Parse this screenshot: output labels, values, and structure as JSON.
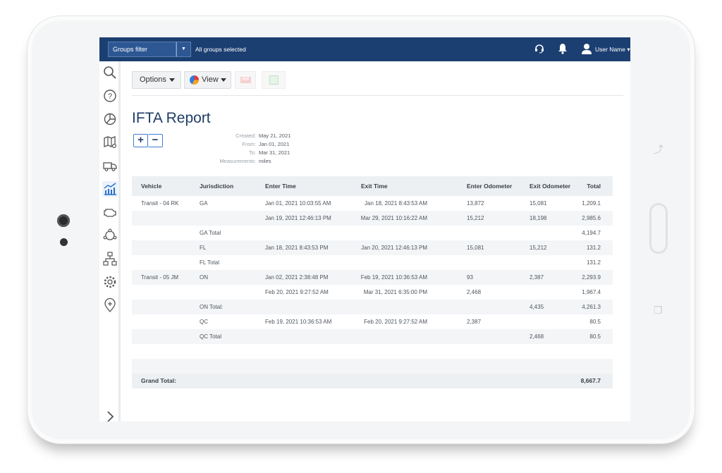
{
  "topbar": {
    "groups_filter_label": "Groups filter",
    "groups_selected": "All groups selected",
    "user_name": "User Name ▾"
  },
  "toolbar": {
    "options_label": "Options",
    "view_label": "View",
    "pdf_label": "PDF"
  },
  "report": {
    "title": "IFTA Report",
    "zoom_in": "+",
    "zoom_out": "−",
    "meta": [
      {
        "label": "Created:",
        "value": "May 21, 2021"
      },
      {
        "label": "From:",
        "value": "Jan 01, 2021"
      },
      {
        "label": "To:",
        "value": "Mar 31, 2021"
      },
      {
        "label": "Measurements:",
        "value": "miles"
      }
    ]
  },
  "table": {
    "headers": [
      "Vehicle",
      "Jurisdiction",
      "Enter Time",
      "Exit Time",
      "Enter Odometer",
      "Exit Odometer",
      "Total"
    ],
    "rows": [
      [
        "Transit - 04 RK",
        "GA",
        "Jan 01, 2021 10:03:55 AM",
        "Jan 18, 2021 8:43:53 AM",
        "13,872",
        "15,081",
        "1,209.1"
      ],
      [
        "",
        "",
        "Jan 19, 2021 12:46:13 PM",
        "Mar 29, 2021 10:16:22 AM",
        "15,212",
        "18,198",
        "2,985.6"
      ],
      [
        "",
        "GA Total",
        "",
        "",
        "",
        "",
        "4,194.7"
      ],
      [
        "",
        "FL",
        "Jan 18, 2021 8:43:53 PM",
        "Jan 20, 2021 12:46:13 PM",
        "15,081",
        "15,212",
        "131.2"
      ],
      [
        "",
        "FL Total",
        "",
        "",
        "",
        "",
        "131.2"
      ],
      [
        "Transit - 05 JM",
        "ON",
        "Jan 02, 2021 2:38:48 PM",
        "Feb 19, 2021 10:36:53 AM",
        "93",
        "2,387",
        "2,293.9"
      ],
      [
        "",
        "",
        "Feb 20, 2021 9:27:52 AM",
        "Mar 31, 2021 6:35:00 PM",
        "2,468",
        "",
        "1,967.4"
      ],
      [
        "",
        "ON Total:",
        "",
        "",
        "",
        "4,435",
        "4,261.3"
      ],
      [
        "",
        "QC",
        "Feb 19, 2021 10:36:53 AM",
        "Feb 20, 2021 9:27:52 AM",
        "2,387",
        "",
        "80.5"
      ],
      [
        "",
        "QC Total",
        "",
        "",
        "",
        "2,468",
        "80.5"
      ]
    ],
    "grand_total_label": "Grand Total:",
    "grand_total_value": "8,667.7"
  },
  "icons": {
    "sidebar": [
      "search-icon",
      "help-icon",
      "pie-chart-icon",
      "map-icon",
      "truck-icon",
      "reports-icon",
      "engine-icon",
      "rules-icon",
      "hierarchy-icon",
      "settings-icon",
      "zone-icon"
    ],
    "brand_color": "#1c3f72",
    "accent_color": "#3f7fd0"
  }
}
